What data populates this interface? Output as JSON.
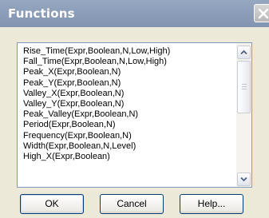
{
  "window": {
    "title": "Functions"
  },
  "functions_list": {
    "items": [
      "Rise_Time(Expr,Boolean,N,Low,High)",
      "Fall_Time(Expr,Boolean,N,Low,High)",
      "Peak_X(Expr,Boolean,N)",
      "Peak_Y(Expr,Boolean,N)",
      "Valley_X(Expr,Boolean,N)",
      "Valley_Y(Expr,Boolean,N)",
      "Peak_Valley(Expr,Boolean,N)",
      "Period(Expr,Boolean,N)",
      "Frequency(Expr,Boolean,N)",
      "Width(Expr,Boolean,N,Level)",
      "High_X(Expr,Boolean)"
    ]
  },
  "buttons": {
    "ok": "OK",
    "cancel": "Cancel",
    "help": "Help..."
  },
  "icons": {
    "close": "close-icon",
    "scroll_up": "arrow-up-icon",
    "scroll_down": "arrow-down-icon"
  },
  "colors": {
    "titlebar": "#8c9eb9",
    "dialog_background": "#ece9d8",
    "list_border": "#7f9db9",
    "button_border": "#003c74"
  }
}
